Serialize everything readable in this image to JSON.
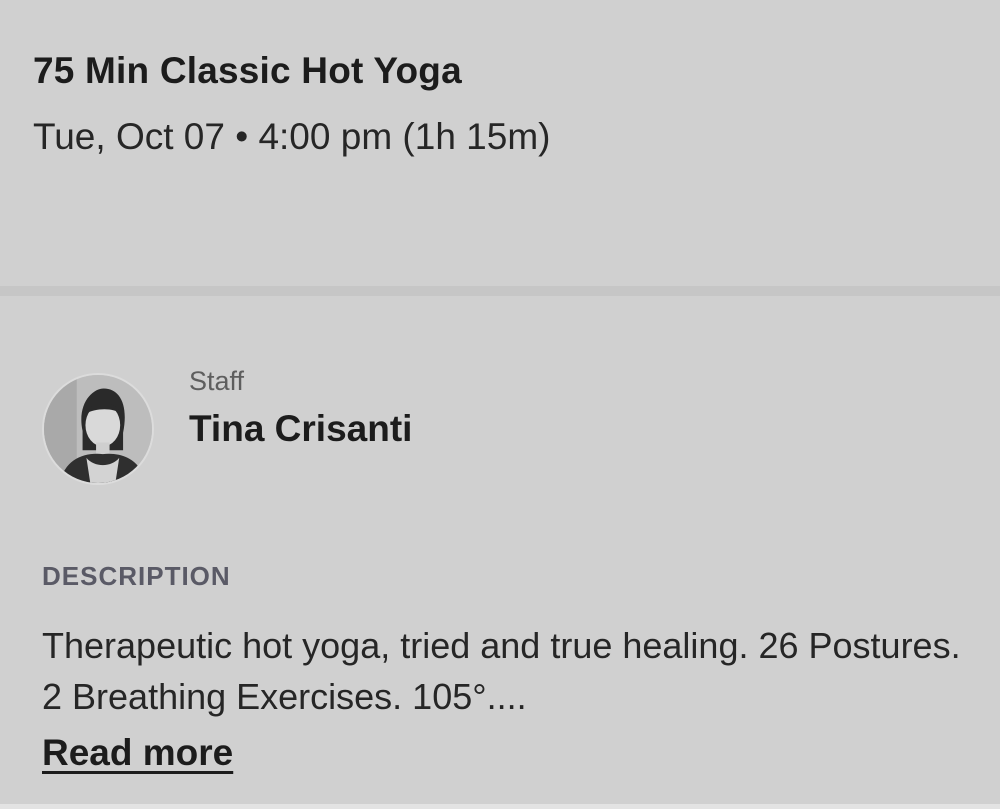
{
  "class": {
    "title": "75 Min Classic Hot Yoga",
    "datetime": "Tue, Oct 07 • 4:00 pm (1h 15m)"
  },
  "staff": {
    "role_label": "Staff",
    "name": "Tina Crisanti",
    "avatar_icon": "staff-photo"
  },
  "description": {
    "heading": "DESCRIPTION",
    "text": "Therapeutic hot yoga, tried and true healing. 26 Postures. 2 Breathing Exercises. 105°....",
    "read_more_label": "Read more"
  },
  "colors": {
    "background": "#d0d0d0",
    "divider": "#c6c6c6",
    "heading_muted": "#5a5a66"
  }
}
